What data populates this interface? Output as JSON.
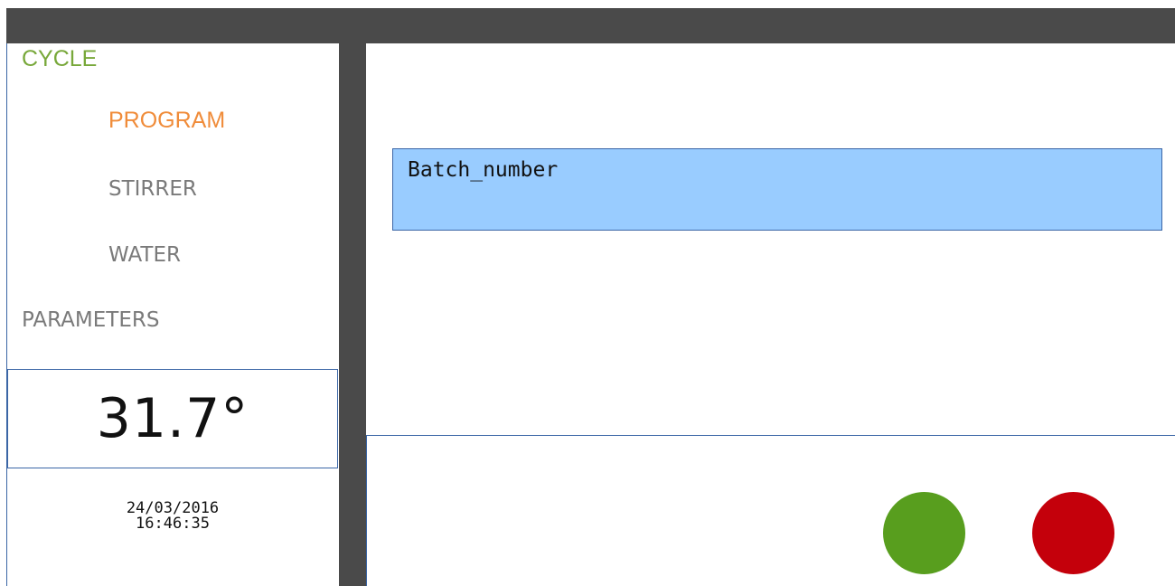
{
  "nav": {
    "cycle": "CYCLE",
    "program": "PROGRAM",
    "stirrer": "STIRRER",
    "water": "WATER",
    "parameters": "PARAMETERS"
  },
  "status": {
    "temperature": "31.7°",
    "date": "24/03/2016",
    "time": "16:46:35"
  },
  "main": {
    "batch_field_value": "Batch_number"
  },
  "colors": {
    "cycle": "#78a83a",
    "program_active": "#f08c3a",
    "inactive": "#7a7a7a",
    "bar": "#4a4a4a",
    "field_bg": "#99ccff",
    "start_green": "#589e1e",
    "stop_red": "#c4000b"
  },
  "buttons": {
    "start": "start-button",
    "stop": "stop-button"
  }
}
